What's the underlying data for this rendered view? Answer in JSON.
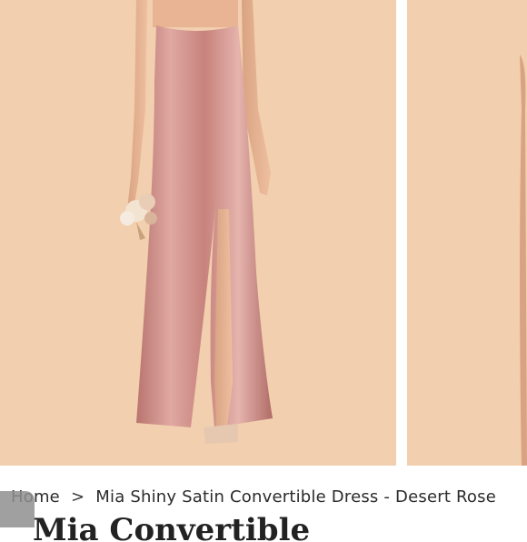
{
  "gallery": {
    "main_image_alt": "Model wearing satin slip dress with side slit holding a small bouquet",
    "next_image_alt": "Next product image"
  },
  "breadcrumb": {
    "home": "Home",
    "separator": ">",
    "current": "Mia Shiny Satin Convertible Dress - Desert Rose"
  },
  "product": {
    "title_peek": "Mia Convertible"
  },
  "colors": {
    "backdrop": "#f2cfae",
    "dress": "#c98a86",
    "text": "#2b2b2b"
  }
}
